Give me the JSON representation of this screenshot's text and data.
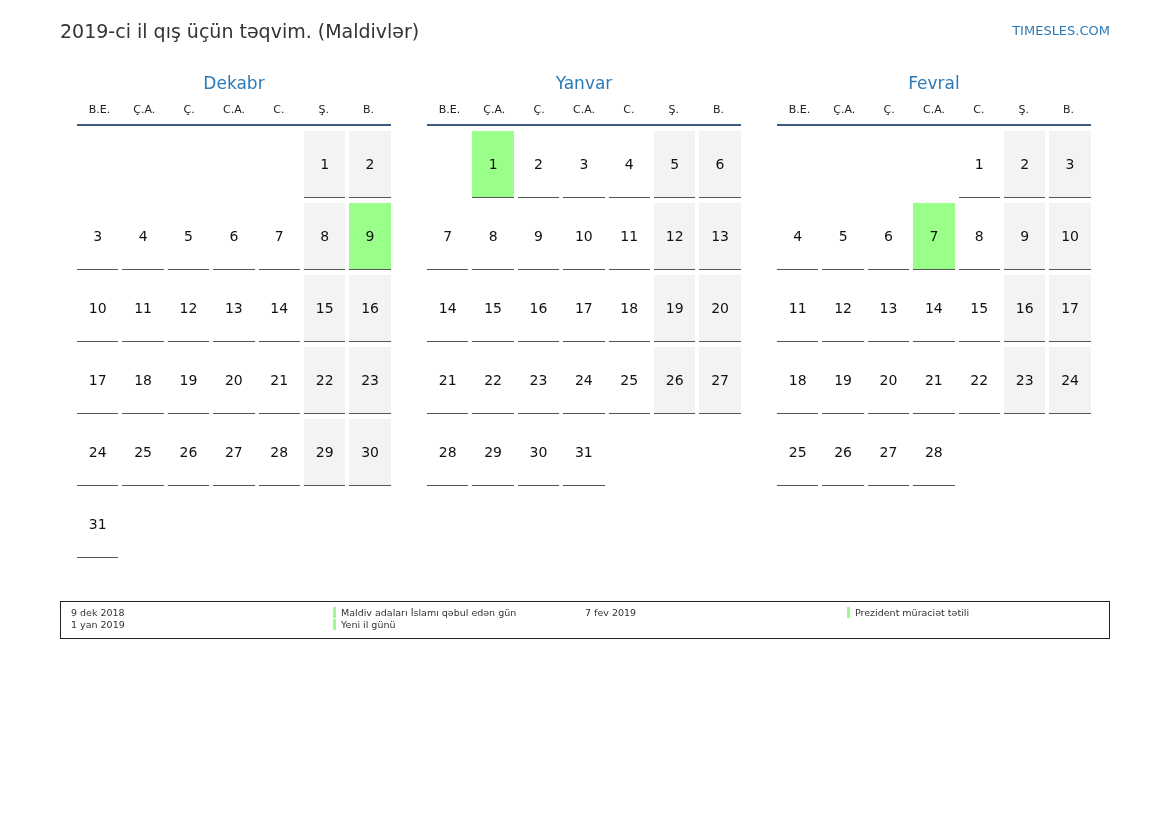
{
  "title": "2019-ci il qış üçün təqvim. (Maldivlər)",
  "site": "TIMESLES.COM",
  "months": [
    {
      "name": "Dekabr",
      "weekdays": [
        {
          "label": "B.E.",
          "weekend": false
        },
        {
          "label": "Ç.A.",
          "weekend": false
        },
        {
          "label": "Ç.",
          "weekend": false
        },
        {
          "label": "C.A.",
          "weekend": false
        },
        {
          "label": "C.",
          "weekend": false
        },
        {
          "label": "Ş.",
          "weekend": true
        },
        {
          "label": "B.",
          "weekend": true
        }
      ],
      "weeks": [
        {
          "kind": "first",
          "days": [
            {
              "day": "1",
              "holiday": false
            },
            {
              "day": "2",
              "holiday": false
            }
          ]
        },
        {
          "kind": "full",
          "days": [
            {
              "day": "3",
              "holiday": false
            },
            {
              "day": "4",
              "holiday": false
            },
            {
              "day": "5",
              "holiday": false
            },
            {
              "day": "6",
              "holiday": false
            },
            {
              "day": "7",
              "holiday": false
            },
            {
              "day": "8",
              "holiday": false
            },
            {
              "day": "9",
              "holiday": true
            }
          ]
        },
        {
          "kind": "full",
          "days": [
            {
              "day": "10",
              "holiday": false
            },
            {
              "day": "11",
              "holiday": false
            },
            {
              "day": "12",
              "holiday": false
            },
            {
              "day": "13",
              "holiday": false
            },
            {
              "day": "14",
              "holiday": false
            },
            {
              "day": "15",
              "holiday": false
            },
            {
              "day": "16",
              "holiday": false
            }
          ]
        },
        {
          "kind": "full",
          "days": [
            {
              "day": "17",
              "holiday": false
            },
            {
              "day": "18",
              "holiday": false
            },
            {
              "day": "19",
              "holiday": false
            },
            {
              "day": "20",
              "holiday": false
            },
            {
              "day": "21",
              "holiday": false
            },
            {
              "day": "22",
              "holiday": false
            },
            {
              "day": "23",
              "holiday": false
            }
          ]
        },
        {
          "kind": "full",
          "days": [
            {
              "day": "24",
              "holiday": false
            },
            {
              "day": "25",
              "holiday": false
            },
            {
              "day": "26",
              "holiday": false
            },
            {
              "day": "27",
              "holiday": false
            },
            {
              "day": "28",
              "holiday": false
            },
            {
              "day": "29",
              "holiday": false
            },
            {
              "day": "30",
              "holiday": false
            }
          ]
        },
        {
          "kind": "last",
          "days": [
            {
              "day": "31",
              "holiday": false
            }
          ]
        }
      ]
    },
    {
      "name": "Yanvar",
      "weekdays": [
        {
          "label": "B.E.",
          "weekend": false
        },
        {
          "label": "Ç.A.",
          "weekend": false
        },
        {
          "label": "Ç.",
          "weekend": false
        },
        {
          "label": "C.A.",
          "weekend": false
        },
        {
          "label": "C.",
          "weekend": false
        },
        {
          "label": "Ş.",
          "weekend": true
        },
        {
          "label": "B.",
          "weekend": true
        }
      ],
      "weeks": [
        {
          "kind": "first",
          "days": [
            {
              "day": "1",
              "holiday": true
            },
            {
              "day": "2",
              "holiday": false
            },
            {
              "day": "3",
              "holiday": false
            },
            {
              "day": "4",
              "holiday": false
            },
            {
              "day": "5",
              "holiday": false
            },
            {
              "day": "6",
              "holiday": false
            }
          ]
        },
        {
          "kind": "full",
          "days": [
            {
              "day": "7",
              "holiday": false
            },
            {
              "day": "8",
              "holiday": false
            },
            {
              "day": "9",
              "holiday": false
            },
            {
              "day": "10",
              "holiday": false
            },
            {
              "day": "11",
              "holiday": false
            },
            {
              "day": "12",
              "holiday": false
            },
            {
              "day": "13",
              "holiday": false
            }
          ]
        },
        {
          "kind": "full",
          "days": [
            {
              "day": "14",
              "holiday": false
            },
            {
              "day": "15",
              "holiday": false
            },
            {
              "day": "16",
              "holiday": false
            },
            {
              "day": "17",
              "holiday": false
            },
            {
              "day": "18",
              "holiday": false
            },
            {
              "day": "19",
              "holiday": false
            },
            {
              "day": "20",
              "holiday": false
            }
          ]
        },
        {
          "kind": "full",
          "days": [
            {
              "day": "21",
              "holiday": false
            },
            {
              "day": "22",
              "holiday": false
            },
            {
              "day": "23",
              "holiday": false
            },
            {
              "day": "24",
              "holiday": false
            },
            {
              "day": "25",
              "holiday": false
            },
            {
              "day": "26",
              "holiday": false
            },
            {
              "day": "27",
              "holiday": false
            }
          ]
        },
        {
          "kind": "last",
          "days": [
            {
              "day": "28",
              "holiday": false
            },
            {
              "day": "29",
              "holiday": false
            },
            {
              "day": "30",
              "holiday": false
            },
            {
              "day": "31",
              "holiday": false
            }
          ]
        }
      ]
    },
    {
      "name": "Fevral",
      "weekdays": [
        {
          "label": "B.E.",
          "weekend": false
        },
        {
          "label": "Ç.A.",
          "weekend": false
        },
        {
          "label": "Ç.",
          "weekend": false
        },
        {
          "label": "C.A.",
          "weekend": false
        },
        {
          "label": "C.",
          "weekend": false
        },
        {
          "label": "Ş.",
          "weekend": true
        },
        {
          "label": "B.",
          "weekend": true
        }
      ],
      "weeks": [
        {
          "kind": "first",
          "days": [
            {
              "day": "1",
              "holiday": false
            },
            {
              "day": "2",
              "holiday": false
            },
            {
              "day": "3",
              "holiday": false
            }
          ]
        },
        {
          "kind": "full",
          "days": [
            {
              "day": "4",
              "holiday": false
            },
            {
              "day": "5",
              "holiday": false
            },
            {
              "day": "6",
              "holiday": false
            },
            {
              "day": "7",
              "holiday": true
            },
            {
              "day": "8",
              "holiday": false
            },
            {
              "day": "9",
              "holiday": false
            },
            {
              "day": "10",
              "holiday": false
            }
          ]
        },
        {
          "kind": "full",
          "days": [
            {
              "day": "11",
              "holiday": false
            },
            {
              "day": "12",
              "holiday": false
            },
            {
              "day": "13",
              "holiday": false
            },
            {
              "day": "14",
              "holiday": false
            },
            {
              "day": "15",
              "holiday": false
            },
            {
              "day": "16",
              "holiday": false
            },
            {
              "day": "17",
              "holiday": false
            }
          ]
        },
        {
          "kind": "full",
          "days": [
            {
              "day": "18",
              "holiday": false
            },
            {
              "day": "19",
              "holiday": false
            },
            {
              "day": "20",
              "holiday": false
            },
            {
              "day": "21",
              "holiday": false
            },
            {
              "day": "22",
              "holiday": false
            },
            {
              "day": "23",
              "holiday": false
            },
            {
              "day": "24",
              "holiday": false
            }
          ]
        },
        {
          "kind": "last",
          "days": [
            {
              "day": "25",
              "holiday": false
            },
            {
              "day": "26",
              "holiday": false
            },
            {
              "day": "27",
              "holiday": false
            },
            {
              "day": "28",
              "holiday": false
            }
          ]
        }
      ]
    }
  ],
  "legend": [
    [
      {
        "date": "9 dek 2018",
        "name": "Maldiv adaları İslamı qəbul edən gün",
        "color": "#99ff88"
      },
      {
        "date": "1 yan 2019",
        "name": "Yeni il günü",
        "color": "#99ff88"
      }
    ],
    [
      {
        "date": "7 fev 2019",
        "name": "Prezident müraciət tətili",
        "color": "#99ff88"
      }
    ]
  ]
}
